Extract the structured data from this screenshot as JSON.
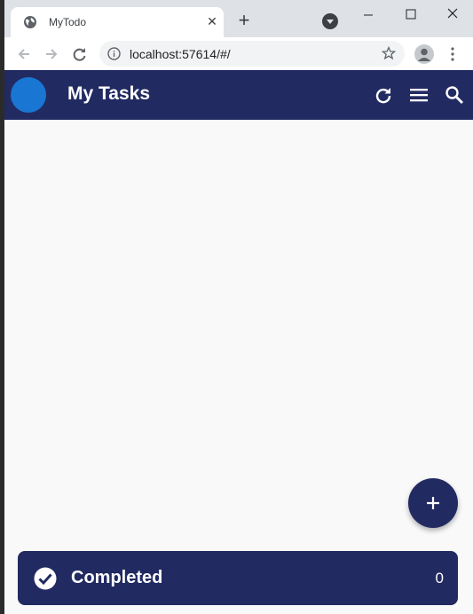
{
  "browser": {
    "tab_title": "MyTodo",
    "url": "localhost:57614/#/",
    "new_tab_symbol": "+",
    "tab_close_symbol": "✕"
  },
  "app": {
    "title": "My Tasks",
    "completed_label": "Completed",
    "completed_count": "0"
  },
  "colors": {
    "appbar": "#222a62",
    "avatar": "#1976d2",
    "background": "#f9f9f9"
  },
  "icons": [
    "globe-icon",
    "back-icon",
    "forward-icon",
    "reload-icon",
    "info-icon",
    "star-icon",
    "profile-icon",
    "more-vert-icon",
    "refresh-icon",
    "menu-icon",
    "search-icon",
    "add-icon",
    "check-circle-icon"
  ]
}
